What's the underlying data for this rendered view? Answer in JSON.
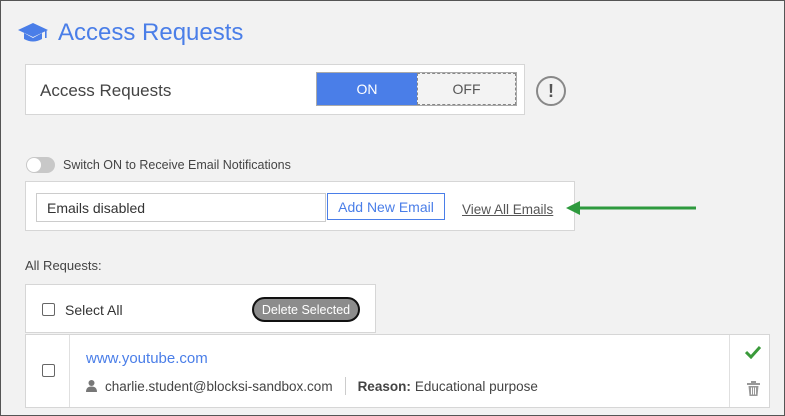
{
  "header": {
    "title": "Access Requests",
    "icon": "graduation-cap-icon"
  },
  "access": {
    "label": "Access Requests",
    "on_label": "ON",
    "off_label": "OFF",
    "info_glyph": "!"
  },
  "notifications": {
    "switch_label": "Switch ON to Receive Email Notifications",
    "enabled": false
  },
  "email": {
    "input_value": "Emails disabled",
    "add_button": "Add New Email",
    "view_link": "View All Emails"
  },
  "requests": {
    "section_label": "All Requests:",
    "select_all": "Select All",
    "delete_selected": "Delete Selected",
    "items": [
      {
        "site": "www.youtube.com",
        "user": "charlie.student@blocksi-sandbox.com",
        "reason_label": "Reason:",
        "reason": "Educational purpose"
      }
    ]
  },
  "colors": {
    "accent": "#4a7ee8",
    "approve": "#3a9a3a",
    "arrow": "#2e9a3e"
  }
}
